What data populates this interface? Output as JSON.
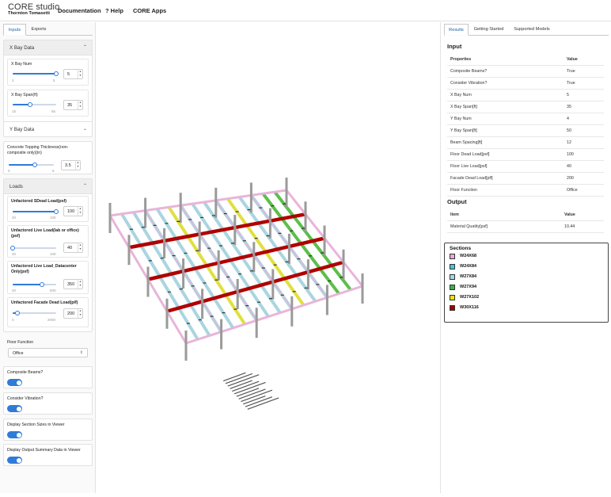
{
  "header": {
    "logo_main": "CORE studio",
    "logo_sub": "Thornton Tomasetti",
    "nav": [
      "Documentation",
      "? Help",
      "CORE Apps"
    ]
  },
  "left": {
    "tabs": [
      "Inputs",
      "Exports"
    ],
    "x_bay": {
      "title": "X Bay Data",
      "num": {
        "label": "X Bay Num",
        "value": "5",
        "min": "3",
        "max": "5",
        "fraction": 1.0
      },
      "span": {
        "label": "X Bay Span(ft)",
        "value": "35",
        "min": "15",
        "max": "65",
        "fraction": 0.4
      }
    },
    "y_bay": {
      "title": "Y Bay Data"
    },
    "topping": {
      "label": "Concrete Topping Thickness(non-composite only)(in)",
      "value": "3.5",
      "min": "0",
      "max": "6",
      "fraction": 0.58
    },
    "loads": {
      "title": "Loads",
      "items": [
        {
          "label": "Unfactored SDead Load(psf)",
          "value": "100",
          "min": "20",
          "max": "100",
          "fraction": 1.0
        },
        {
          "label": "Unfactored Live Load(lab or office)(psf)",
          "value": "40",
          "min": "40",
          "max": "100",
          "fraction": 0.0
        },
        {
          "label": "Unfactored Live Load_Datacenter Only(psf)",
          "value": "350",
          "min": "40",
          "max": "500",
          "fraction": 0.67
        },
        {
          "label": "Unfactored Facade Dead Load(plf)",
          "value": "200",
          "min": "0",
          "max": "2000",
          "fraction": 0.1
        }
      ]
    },
    "floor_function": {
      "label": "Floor Function",
      "value": "Office"
    },
    "toggles": [
      {
        "label": "Composite Beams?",
        "on": true
      },
      {
        "label": "Consider Vibration?",
        "on": true
      },
      {
        "label": "Display Section Sizes in Viewer",
        "on": true
      },
      {
        "label": "Display Output Summary Data in Viewer",
        "on": true
      }
    ]
  },
  "right": {
    "tabs": [
      "Results",
      "Getting Started",
      "Supported Models"
    ],
    "input_title": "Input",
    "input_header": [
      "Properties",
      "Value"
    ],
    "input_rows": [
      [
        "Composite Beams?",
        "True"
      ],
      [
        "Consider Vibration?",
        "True"
      ],
      [
        "X Bay Num",
        "5"
      ],
      [
        "X Bay Span[ft]",
        "35"
      ],
      [
        "Y Bay Num",
        "4"
      ],
      [
        "Y Bay Span[ft]",
        "50"
      ],
      [
        "Beam Spacing[ft]",
        "12"
      ],
      [
        "Floor Dead Load[psf]",
        "100"
      ],
      [
        "Floor Live Load[psf]",
        "40"
      ],
      [
        "Facade Dead Load[plf]",
        "200"
      ],
      [
        "Floor Function",
        "Office"
      ]
    ],
    "output_title": "Output",
    "output_header": [
      "Item",
      "Value"
    ],
    "output_rows": [
      [
        "Material Quatity[psf]",
        "10.44"
      ]
    ],
    "legend": {
      "title": "Sections",
      "items": [
        {
          "label": "W24X68",
          "color": "#e8a7d8"
        },
        {
          "label": "W24X84",
          "color": "#4fc1d6"
        },
        {
          "label": "W27X84",
          "color": "#a9d5e0"
        },
        {
          "label": "W27X94",
          "color": "#3cb043"
        },
        {
          "label": "W27X102",
          "color": "#e6e600"
        },
        {
          "label": "W30X116",
          "color": "#a00000"
        }
      ]
    }
  },
  "viewer": {
    "colors": {
      "girder": "#e8b5d9",
      "beam": "#a9d5e0",
      "green": "#5bbf4a",
      "yellow": "#e0e040",
      "red": "#b00000",
      "column": "#9a9a9a"
    }
  }
}
